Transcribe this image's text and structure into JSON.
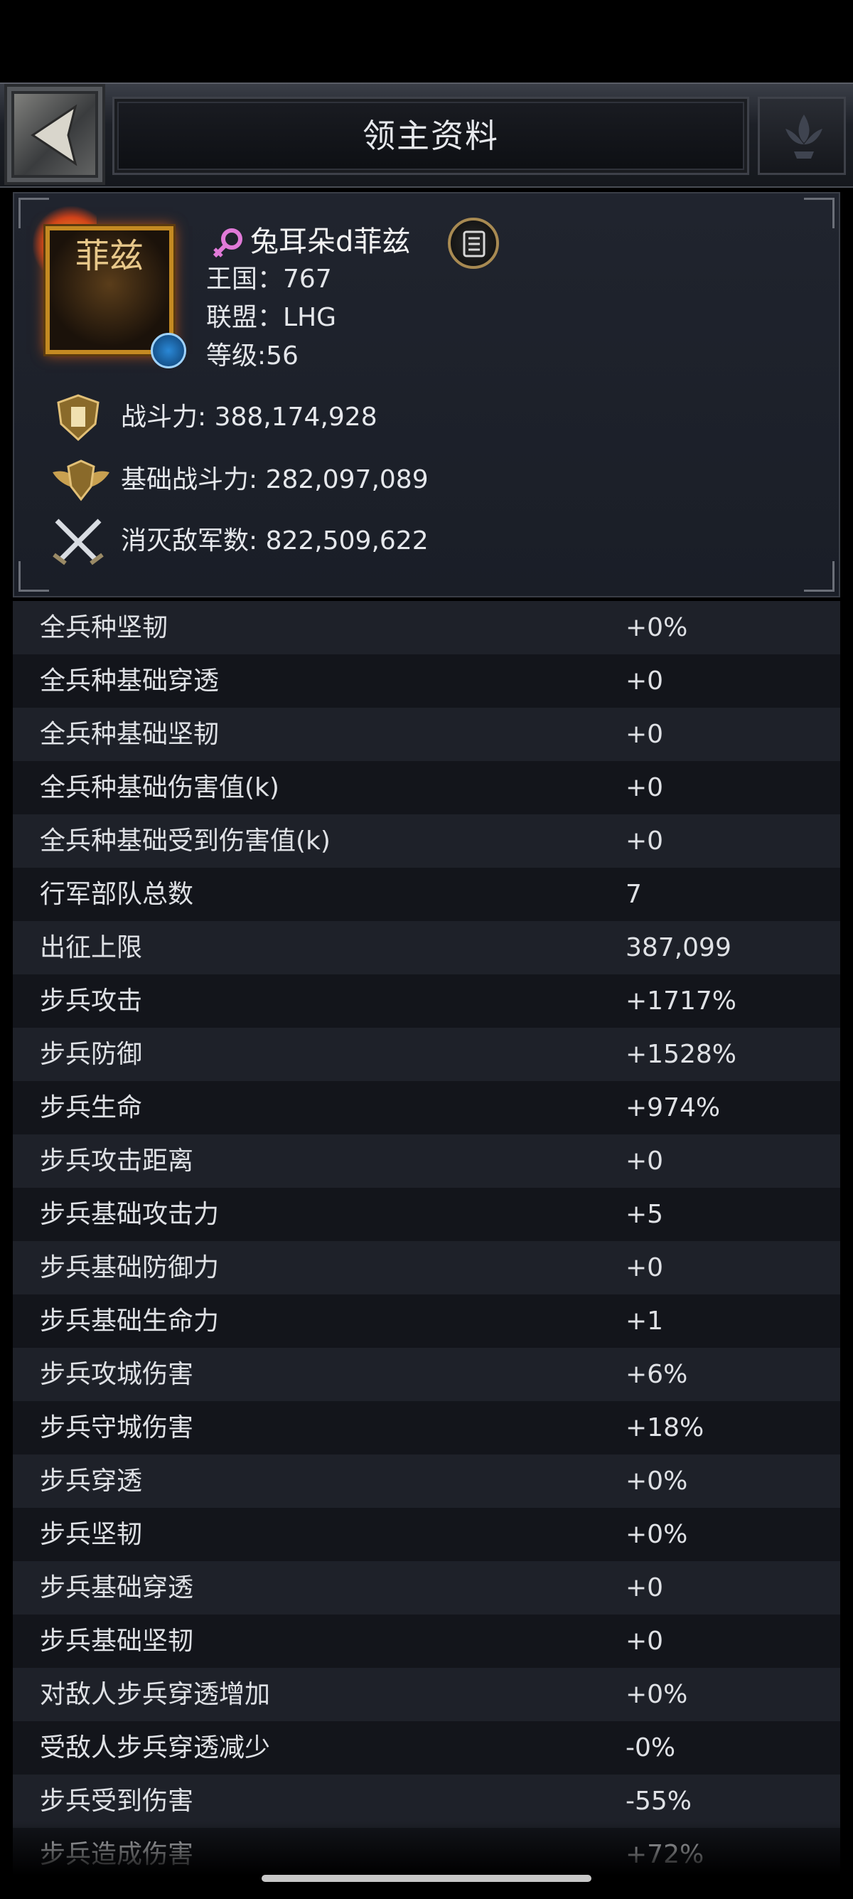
{
  "header": {
    "title": "领主资料"
  },
  "profile": {
    "avatar_text": "菲兹",
    "name": "兔耳朵d菲兹",
    "kingdom_label": "王国：",
    "kingdom": "767",
    "alliance_label": "联盟：",
    "alliance": "LHG",
    "level_label": "等级:",
    "level": "56",
    "stats": [
      {
        "icon": "power-shield-icon",
        "label": "战斗力:",
        "value": "388,174,928"
      },
      {
        "icon": "winged-shield-icon",
        "label": "基础战斗力:",
        "value": "282,097,089"
      },
      {
        "icon": "crossed-swords-icon",
        "label": "消灭敌军数:",
        "value": "822,509,622"
      }
    ]
  },
  "attributes": [
    {
      "label": "全兵种坚韧",
      "value": "+0%"
    },
    {
      "label": "全兵种基础穿透",
      "value": "+0"
    },
    {
      "label": "全兵种基础坚韧",
      "value": "+0"
    },
    {
      "label": "全兵种基础伤害值(k)",
      "value": "+0"
    },
    {
      "label": "全兵种基础受到伤害值(k)",
      "value": "+0"
    },
    {
      "label": "行军部队总数",
      "value": "7"
    },
    {
      "label": "出征上限",
      "value": "387,099"
    },
    {
      "label": "步兵攻击",
      "value": "+1717%"
    },
    {
      "label": "步兵防御",
      "value": "+1528%"
    },
    {
      "label": "步兵生命",
      "value": "+974%"
    },
    {
      "label": "步兵攻击距离",
      "value": "+0"
    },
    {
      "label": "步兵基础攻击力",
      "value": "+5"
    },
    {
      "label": "步兵基础防御力",
      "value": "+0"
    },
    {
      "label": "步兵基础生命力",
      "value": "+1"
    },
    {
      "label": "步兵攻城伤害",
      "value": "+6%"
    },
    {
      "label": "步兵守城伤害",
      "value": "+18%"
    },
    {
      "label": "步兵穿透",
      "value": "+0%"
    },
    {
      "label": "步兵坚韧",
      "value": "+0%"
    },
    {
      "label": "步兵基础穿透",
      "value": "+0"
    },
    {
      "label": "步兵基础坚韧",
      "value": "+0"
    },
    {
      "label": "对敌人步兵穿透增加",
      "value": "+0%"
    },
    {
      "label": "受敌人步兵穿透减少",
      "value": "-0%"
    },
    {
      "label": "步兵受到伤害",
      "value": "-55%"
    },
    {
      "label": "步兵造成伤害",
      "value": "+72%"
    }
  ],
  "colors": {
    "accent_gold": "#c48a22",
    "female_icon": "#e07ad8",
    "row_odd": "#1e2129",
    "row_even": "#13151b"
  }
}
